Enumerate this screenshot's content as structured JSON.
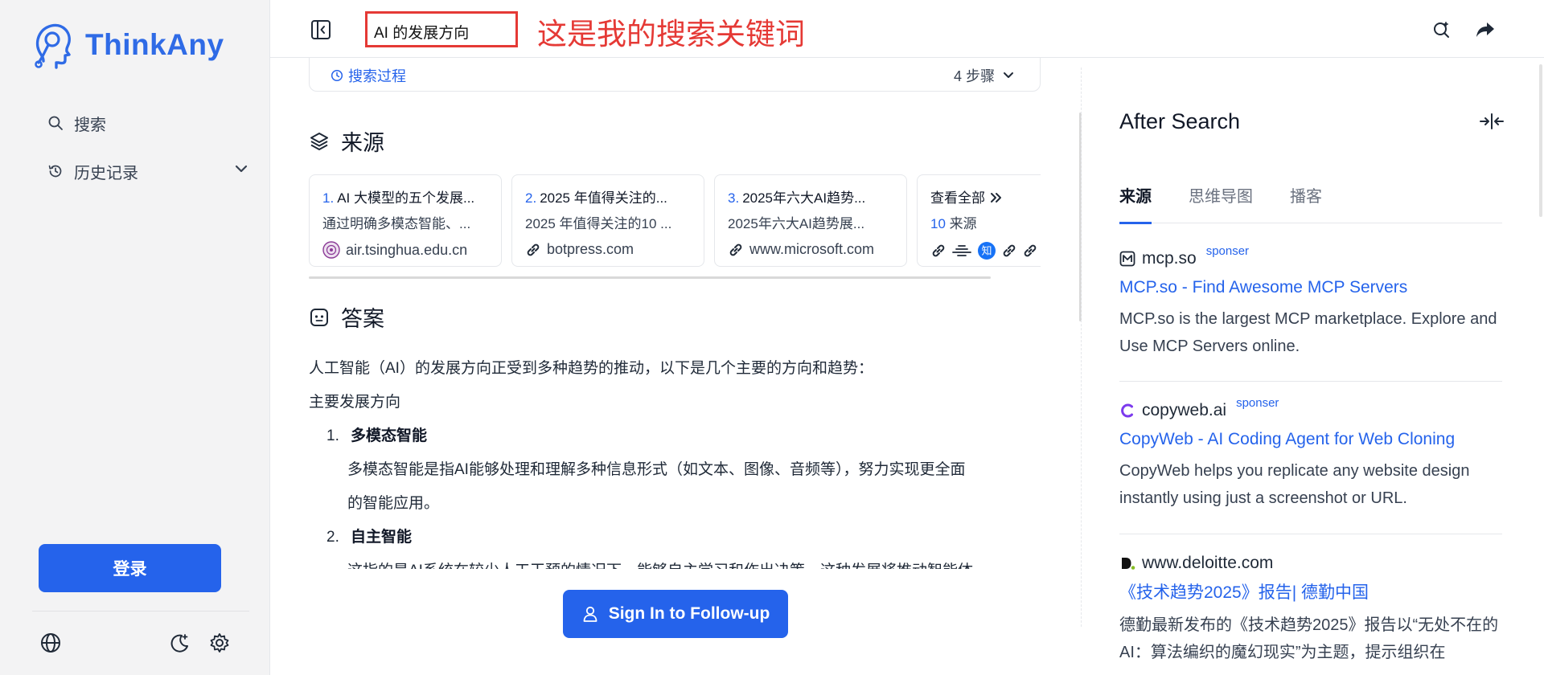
{
  "sidebar": {
    "brand": "ThinkAny",
    "nav": [
      {
        "label": "搜索",
        "icon": "search-icon"
      },
      {
        "label": "历史记录",
        "icon": "history-icon"
      }
    ],
    "login_label": "登录"
  },
  "header": {
    "query": "AI 的发展方向",
    "annotation": "这是我的搜索关键词"
  },
  "main": {
    "process_label": "搜索过程",
    "process_steps": "4 步骤",
    "sources_title": "来源",
    "sources": [
      {
        "num": "1.",
        "title": "AI 大模型的五个发展...",
        "desc": "通过明确多模态智能、...",
        "site": "air.tsinghua.edu.cn"
      },
      {
        "num": "2.",
        "title": "2025 年值得关注的...",
        "desc": "2025 年值得关注的10 ...",
        "site": "botpress.com"
      },
      {
        "num": "3.",
        "title": "2025年六大AI趋势...",
        "desc": "2025年六大AI趋势展...",
        "site": "www.microsoft.com"
      }
    ],
    "view_all": "查看全部",
    "view_all_count": "10",
    "view_all_suffix": "来源",
    "answer_title": "答案",
    "answer_intro": "人工智能（AI）的发展方向正受到多种趋势的推动，以下是几个主要的方向和趋势：",
    "answer_subhead": "主要发展方向",
    "answer_items": [
      {
        "num": "1.",
        "title": "多模态智能",
        "lines": [
          "多模态智能是指AI能够处理和理解多种信息形式（如文本、图像、音频等），努力实现更全面",
          "的智能应用。"
        ]
      },
      {
        "num": "2.",
        "title": "自主智能",
        "lines": [
          "这指的是AI系统在较少人工干预的情况下，能够自主学习和作出决策，这种发展将推动智能体"
        ]
      }
    ],
    "followup_label": "Sign In to Follow-up"
  },
  "right": {
    "title": "After Search",
    "tabs": [
      "来源",
      "思维导图",
      "播客"
    ],
    "results": [
      {
        "site": "mcp.so",
        "sponsor": "sponser",
        "link": "MCP.so - Find Awesome MCP Servers",
        "desc": "MCP.so is the largest MCP marketplace. Explore and Use MCP Servers online."
      },
      {
        "site": "copyweb.ai",
        "sponsor": "sponser",
        "link": "CopyWeb - AI Coding Agent for Web Cloning",
        "desc": "CopyWeb helps you replicate any website design instantly using just a screenshot or URL."
      },
      {
        "site": "www.deloitte.com",
        "sponsor": "",
        "link": "《技术趋势2025》报告| 德勤中国",
        "desc": "德勤最新发布的《技术趋势2025》报告以“无处不在的AI：算法编织的魔幻现实”为主题，提示组织在"
      }
    ]
  },
  "colors": {
    "accent": "#2563eb",
    "annotation": "#e53935"
  }
}
